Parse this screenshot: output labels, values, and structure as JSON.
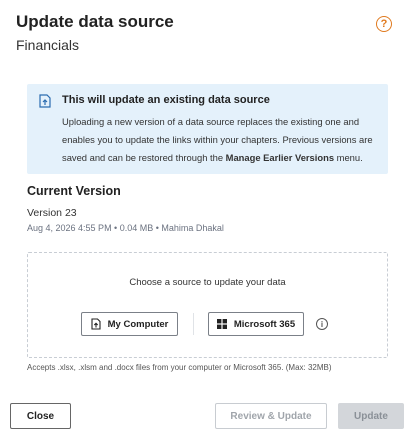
{
  "dialog": {
    "title": "Update data source",
    "subtitle": "Financials",
    "help_icon": "help-circle-icon",
    "help_glyph": "?"
  },
  "info": {
    "icon": "upload-file-icon",
    "title": "This will update an existing data source",
    "text_part1": "Uploading a new version of a data source replaces the existing one and enables you to update the links within your chapters. Previous versions are saved and can be restored through the ",
    "text_bold": "Manage Earlier Versions",
    "text_part2": " menu."
  },
  "current_version": {
    "heading": "Current Version",
    "version": "Version 23",
    "meta": "Aug 4, 2026 4:55 PM • 0.04 MB • Mahima Dhakal"
  },
  "source": {
    "prompt": "Choose a source to update your data",
    "my_computer_label": "My Computer",
    "microsoft365_label": "Microsoft 365",
    "info_glyph": "i",
    "accepts": "Accepts .xlsx, .xlsm and .docx files from your computer or Microsoft 365. (Max: 32MB)"
  },
  "footer": {
    "close_label": "Close",
    "review_label": "Review & Update",
    "update_label": "Update"
  },
  "colors": {
    "accent_orange": "#e07a1f",
    "info_bg": "#e4f1fb",
    "info_icon_blue": "#2b6cb0"
  }
}
